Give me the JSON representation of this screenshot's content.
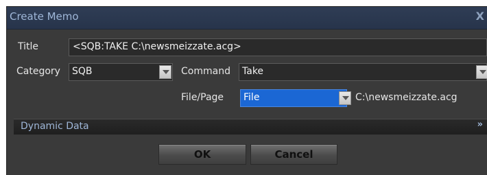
{
  "window": {
    "title": "Create Memo",
    "close_glyph": "X"
  },
  "form": {
    "title_label": "Title",
    "title_value": "<SQB:TAKE C:\\newsmeizzate.acg>",
    "category_label": "Category",
    "category_value": "SQB",
    "command_label": "Command",
    "command_value": "Take",
    "filepage_label": "File/Page",
    "filepage_value": "File",
    "filepath_text": "C:\\newsmeizzate.acg"
  },
  "dynamic_data": {
    "label": "Dynamic Data",
    "expand_glyph": "»"
  },
  "buttons": {
    "ok_label": "OK",
    "cancel_label": "Cancel"
  },
  "colors": {
    "titlebar": "#2f3d55",
    "selection": "#1b67d4",
    "panel": "#3a3a3a"
  }
}
